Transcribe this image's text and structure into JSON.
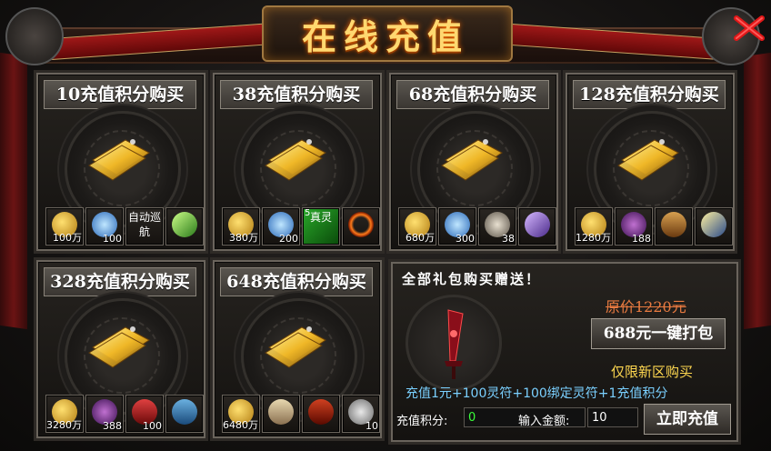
{
  "title": "在线充值",
  "colors": {
    "gold": "#ffd870",
    "red": "#a01818",
    "promo_text": "#7ad0ff",
    "highlight": "#ffd850"
  },
  "cards": [
    {
      "label": "10充值积分购买",
      "items": [
        {
          "icon": "gold-coins-icon",
          "qty": "100万"
        },
        {
          "icon": "blue-crystal-icon",
          "qty": "100"
        },
        {
          "icon": "auto-patrol",
          "text": "自动巡航"
        },
        {
          "icon": "green-dagger-icon",
          "qty": ""
        }
      ]
    },
    {
      "label": "38充值积分购买",
      "items": [
        {
          "icon": "gold-coins-icon",
          "qty": "380万"
        },
        {
          "icon": "blue-crystal-icon",
          "qty": "200"
        },
        {
          "icon": "green-talisman-icon",
          "text": "真灵",
          "badge": "5"
        },
        {
          "icon": "fire-ring-icon",
          "qty": ""
        }
      ]
    },
    {
      "label": "68充值积分购买",
      "items": [
        {
          "icon": "gold-coins-icon",
          "qty": "680万"
        },
        {
          "icon": "blue-crystal-icon",
          "qty": "300"
        },
        {
          "icon": "silver-amulet-icon",
          "qty": "38"
        },
        {
          "icon": "purple-dagger-icon",
          "qty": ""
        }
      ]
    },
    {
      "label": "128充值积分购买",
      "items": [
        {
          "icon": "gold-coins-icon",
          "qty": "1280万"
        },
        {
          "icon": "purple-egg-icon",
          "qty": "188"
        },
        {
          "icon": "treasure-chest-icon",
          "qty": ""
        },
        {
          "icon": "golden-dagger-icon",
          "qty": ""
        }
      ]
    },
    {
      "label": "328充值积分购买",
      "items": [
        {
          "icon": "gold-coins-icon",
          "qty": "3280万"
        },
        {
          "icon": "purple-egg-icon",
          "qty": "388"
        },
        {
          "icon": "red-scroll-icon",
          "qty": "100"
        },
        {
          "icon": "blue-book-icon",
          "qty": ""
        }
      ]
    },
    {
      "label": "648充值积分购买",
      "items": [
        {
          "icon": "gold-coins-icon",
          "qty": "6480万"
        },
        {
          "icon": "scroll-icon",
          "qty": ""
        },
        {
          "icon": "red-chest-icon",
          "qty": ""
        },
        {
          "icon": "dragon-pet-icon",
          "qty": "10"
        }
      ]
    }
  ],
  "promo": {
    "heading": "全部礼包购买赠送！",
    "original_price": "原价1220元",
    "pack_button": "688元一键打包",
    "new_server_only": "仅限新区购买",
    "description": "充值1元+100灵符+100绑定灵符+1充值积分"
  },
  "recharge": {
    "points_label": "充值积分:",
    "points_value": "0",
    "amount_label": "输入金额:",
    "amount_value": "10",
    "submit": "立即充值"
  }
}
